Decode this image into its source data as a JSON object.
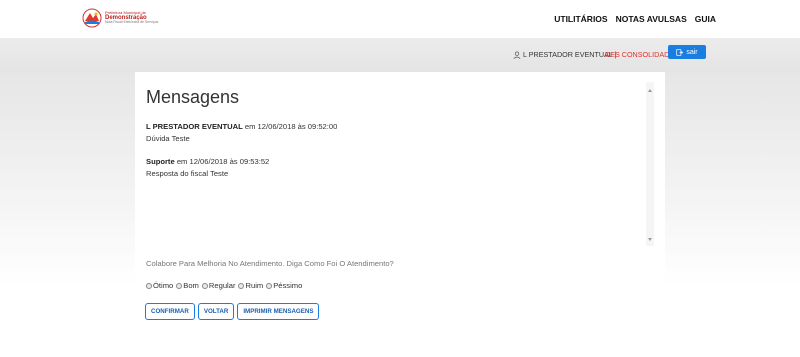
{
  "header": {
    "logo": {
      "line1": "Prefeitura Municipal de",
      "line2": "Demonstração",
      "line3": "Nota Fiscal Eletrônica de Serviços"
    },
    "nav": [
      {
        "label": "UTILITÁRIOS"
      },
      {
        "label": "NOTAS AVULSAS"
      },
      {
        "label": "GUIA"
      }
    ]
  },
  "userbar": {
    "user": "L PRESTADOR EVENTUAL |",
    "status": "DES CONSOLIDADA",
    "logout": "sair"
  },
  "main": {
    "title": "Mensagens",
    "messages": [
      {
        "author": "L PRESTADOR EVENTUAL",
        "meta": " em 12/06/2018 às 09:52:00",
        "text": "Dúvida Teste"
      },
      {
        "author": "Suporte",
        "meta": " em 12/06/2018 às 09:53:52",
        "text": "Resposta do fiscal Teste"
      }
    ],
    "question": "Colabore Para Melhoria No Atendimento. Diga Como Foi O Atendimento?",
    "ratings": [
      "Ótimo",
      "Bom",
      "Regular",
      "Ruim",
      "Péssimo"
    ],
    "buttons": {
      "confirm": "CONFIRMAR",
      "back": "VOLTAR",
      "print": "IMPRIMIR MENSAGENS"
    }
  },
  "colors": {
    "accent": "#1a7de0",
    "status": "#e0312d"
  }
}
